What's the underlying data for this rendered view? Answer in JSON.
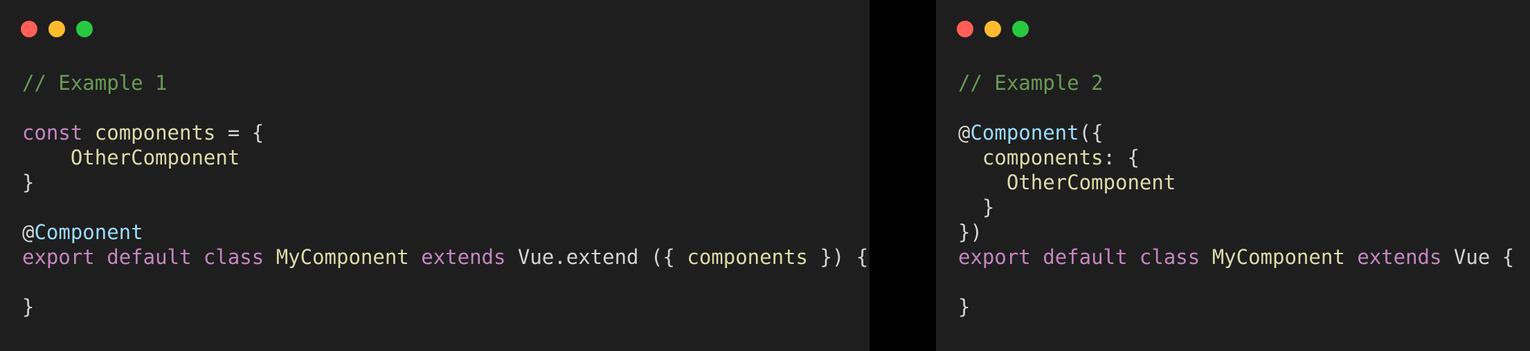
{
  "colors": {
    "background": "#1e1e1e",
    "close": "#ff5f57",
    "minimize": "#febc2e",
    "zoom": "#28c840"
  },
  "panels": [
    {
      "name": "example-1",
      "lines": [
        [
          {
            "t": "comment",
            "v": "// Example 1"
          }
        ],
        [],
        [
          {
            "t": "keyword",
            "v": "const"
          },
          {
            "t": "plain",
            "v": " "
          },
          {
            "t": "ident",
            "v": "components"
          },
          {
            "t": "plain",
            "v": " = {"
          }
        ],
        [
          {
            "t": "plain",
            "v": "    "
          },
          {
            "t": "ident",
            "v": "OtherComponent"
          }
        ],
        [
          {
            "t": "plain",
            "v": "}"
          }
        ],
        [],
        [
          {
            "t": "plain",
            "v": "@"
          },
          {
            "t": "deco",
            "v": "Component"
          }
        ],
        [
          {
            "t": "keyword",
            "v": "export"
          },
          {
            "t": "plain",
            "v": " "
          },
          {
            "t": "keyword",
            "v": "default"
          },
          {
            "t": "plain",
            "v": " "
          },
          {
            "t": "keyword",
            "v": "class"
          },
          {
            "t": "plain",
            "v": " "
          },
          {
            "t": "ident",
            "v": "MyComponent"
          },
          {
            "t": "plain",
            "v": " "
          },
          {
            "t": "keyword",
            "v": "extends"
          },
          {
            "t": "plain",
            "v": " Vue.extend ({ "
          },
          {
            "t": "ident",
            "v": "components"
          },
          {
            "t": "plain",
            "v": " }) {"
          }
        ],
        [],
        [
          {
            "t": "plain",
            "v": "}"
          }
        ]
      ]
    },
    {
      "name": "example-2",
      "lines": [
        [
          {
            "t": "comment",
            "v": "// Example 2"
          }
        ],
        [],
        [
          {
            "t": "plain",
            "v": "@"
          },
          {
            "t": "deco",
            "v": "Component"
          },
          {
            "t": "plain",
            "v": "({"
          }
        ],
        [
          {
            "t": "plain",
            "v": "  "
          },
          {
            "t": "ident",
            "v": "components"
          },
          {
            "t": "plain",
            "v": ": {"
          }
        ],
        [
          {
            "t": "plain",
            "v": "    "
          },
          {
            "t": "ident",
            "v": "OtherComponent"
          }
        ],
        [
          {
            "t": "plain",
            "v": "  }"
          }
        ],
        [
          {
            "t": "plain",
            "v": "})"
          }
        ],
        [
          {
            "t": "keyword",
            "v": "export"
          },
          {
            "t": "plain",
            "v": " "
          },
          {
            "t": "keyword",
            "v": "default"
          },
          {
            "t": "plain",
            "v": " "
          },
          {
            "t": "keyword",
            "v": "class"
          },
          {
            "t": "plain",
            "v": " "
          },
          {
            "t": "ident",
            "v": "MyComponent"
          },
          {
            "t": "plain",
            "v": " "
          },
          {
            "t": "keyword",
            "v": "extends"
          },
          {
            "t": "plain",
            "v": " Vue {"
          }
        ],
        [],
        [
          {
            "t": "plain",
            "v": "}"
          }
        ]
      ]
    }
  ]
}
